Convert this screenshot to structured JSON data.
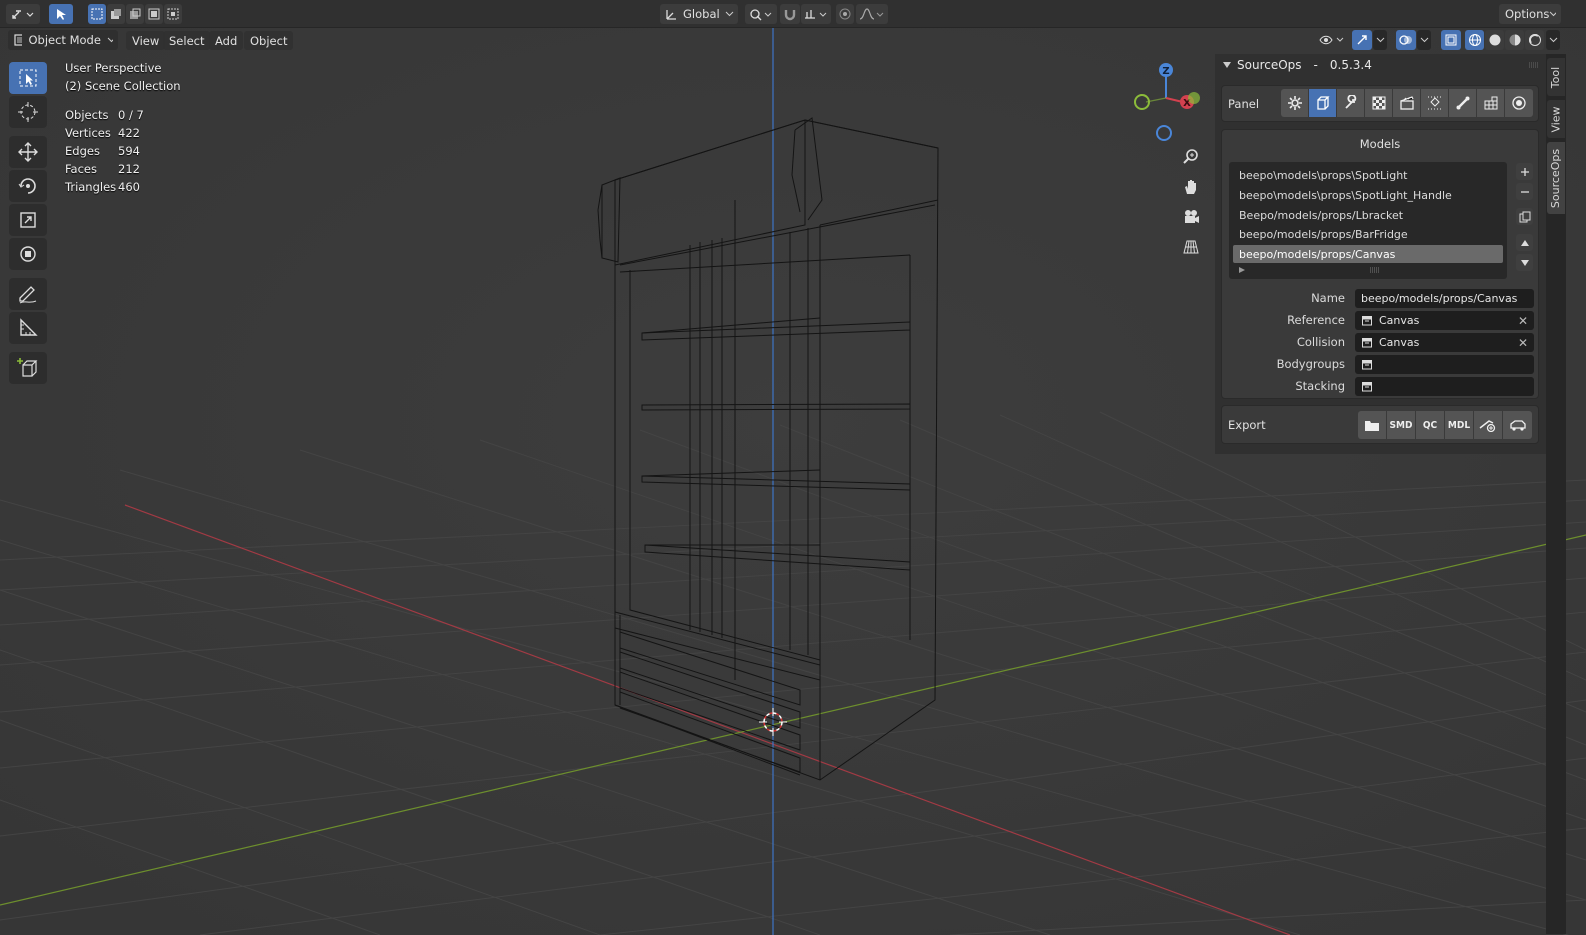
{
  "header": {
    "orientation": "Global",
    "options_label": "Options"
  },
  "menubar": {
    "mode": "Object Mode",
    "items": [
      "View",
      "Select",
      "Add",
      "Object"
    ]
  },
  "overlay": {
    "perspective": "User Perspective",
    "collection": "(2) Scene Collection",
    "stats": [
      {
        "label": "Objects",
        "value": "0 / 7"
      },
      {
        "label": "Vertices",
        "value": "422"
      },
      {
        "label": "Edges",
        "value": "594"
      },
      {
        "label": "Faces",
        "value": "212"
      },
      {
        "label": "Triangles",
        "value": "460"
      }
    ]
  },
  "gizmo": {
    "z_label": "Z",
    "x_label": "X"
  },
  "sourceops": {
    "title": "SourceOps",
    "separator": "-",
    "version": "0.5.3.4",
    "panel_label": "Panel",
    "models_title": "Models",
    "models": [
      "beepo\\models\\props\\SpotLight",
      "beepo\\models\\props\\SpotLight_Handle",
      "Beepo/models/props/Lbracket",
      "beepo/models/props/BarFridge",
      "beepo/models/props/Canvas"
    ],
    "selected_index": 4,
    "props": {
      "name_label": "Name",
      "name_value": "beepo/models/props/Canvas",
      "reference_label": "Reference",
      "reference_value": "Canvas",
      "collision_label": "Collision",
      "collision_value": "Canvas",
      "bodygroups_label": "Bodygroups",
      "stacking_label": "Stacking"
    },
    "export_label": "Export",
    "export_buttons": [
      "SMD",
      "QC",
      "MDL"
    ]
  },
  "tabs": [
    "Tool",
    "View",
    "SourceOps"
  ],
  "colors": {
    "accent": "#4772b3",
    "x_axis": "#d3414f",
    "y_axis": "#8cbc3a",
    "z_axis": "#4a86d8"
  }
}
